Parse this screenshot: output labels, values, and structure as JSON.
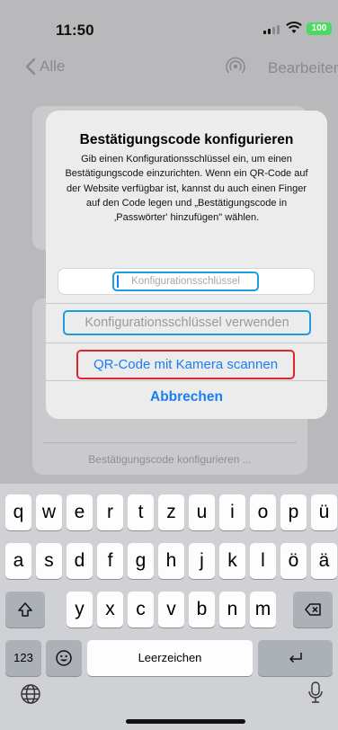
{
  "status": {
    "time": "11:50",
    "battery": "100"
  },
  "nav": {
    "back_label": "Alle",
    "edit_label": "Bearbeiten"
  },
  "background": {
    "footer_text": "Bestätigungscode konfigurieren ..."
  },
  "alert": {
    "title": "Bestätigungscode konfigurieren",
    "message": "Gib einen Konfigurationsschlüssel ein, um einen Bestätigungscode einzurichten. Wenn ein QR-Code auf der Website verfügbar ist, kannst du auch einen Finger auf den Code legen und „Bestätigungscode in ‚Passwörter' hinzufügen\" wählen.",
    "input_placeholder": "Konfigurationsschlüssel",
    "use_key_label": "Konfigurationsschlüssel verwenden",
    "scan_qr_label": "QR-Code mit Kamera scannen",
    "cancel_label": "Abbrechen"
  },
  "keyboard": {
    "row1": [
      "q",
      "w",
      "e",
      "r",
      "t",
      "z",
      "u",
      "i",
      "o",
      "p",
      "ü"
    ],
    "row2": [
      "a",
      "s",
      "d",
      "f",
      "g",
      "h",
      "j",
      "k",
      "l",
      "ö",
      "ä"
    ],
    "row3": [
      "y",
      "x",
      "c",
      "v",
      "b",
      "n",
      "m"
    ],
    "numbers_label": "123",
    "space_label": "Leerzeichen",
    "icons": [
      "shift-icon",
      "delete-icon",
      "emoji-icon",
      "return-icon",
      "globe-icon",
      "microphone-icon"
    ]
  },
  "colors": {
    "accent": "#1a7ff0",
    "highlight_blue": "#1a9fdc",
    "highlight_red": "#e1242c",
    "battery": "#4cd964"
  }
}
